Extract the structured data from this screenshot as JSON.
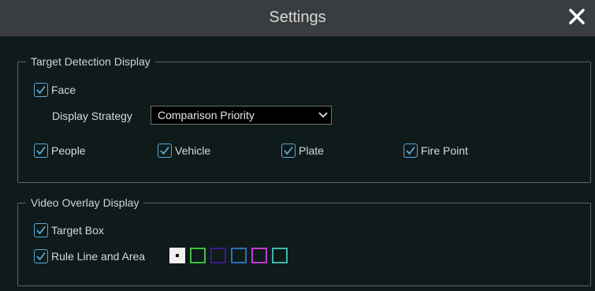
{
  "dialog": {
    "title": "Settings",
    "close_icon": "close-icon"
  },
  "target_detection": {
    "legend": "Target Detection Display",
    "face": {
      "label": "Face",
      "checked": true
    },
    "display_strategy": {
      "label": "Display Strategy",
      "value": "Comparison Priority"
    },
    "types": [
      {
        "label": "People",
        "checked": true
      },
      {
        "label": "Vehicle",
        "checked": true
      },
      {
        "label": "Plate",
        "checked": true
      },
      {
        "label": "Fire Point",
        "checked": true
      }
    ]
  },
  "video_overlay": {
    "legend": "Video Overlay Display",
    "target_box": {
      "label": "Target Box",
      "checked": true
    },
    "rule_line": {
      "label": "Rule Line and Area",
      "checked": true
    },
    "colors": [
      "#f0f0f0",
      "#3fbf3f",
      "#3b1a8c",
      "#2f6fb5",
      "#c03ad1",
      "#3bb8a8"
    ],
    "selected_color_index": 0
  },
  "colors": {
    "checkbox": "#5aa9d6",
    "titlebar": "#3a3d3f",
    "background": "#0f1a1b"
  }
}
